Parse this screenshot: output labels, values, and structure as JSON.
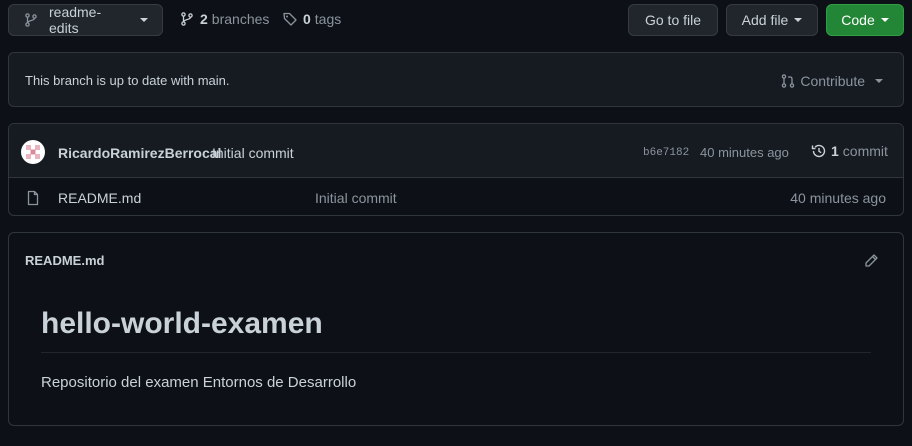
{
  "toolbar": {
    "branch_name": "readme-edits",
    "branches_count": "2",
    "branches_label": "branches",
    "tags_count": "0",
    "tags_label": "tags",
    "go_to_file": "Go to file",
    "add_file": "Add file",
    "code": "Code"
  },
  "branch_status": {
    "message": "This branch is up to date with main.",
    "contribute": "Contribute"
  },
  "latest_commit": {
    "author": "RicardoRamirezBerrocal",
    "message": "Initial commit",
    "sha": "b6e7182",
    "time": "40 minutes ago",
    "commits_count": "1",
    "commits_label": "commit"
  },
  "files": [
    {
      "name": "README.md",
      "commit_message": "Initial commit",
      "time": "40 minutes ago"
    }
  ],
  "readme": {
    "filename": "README.md",
    "heading": "hello-world-examen",
    "body": "Repositorio del examen Entornos de Desarrollo"
  },
  "colors": {
    "background": "#0d1117",
    "border": "#30363d",
    "button_bg": "#21262d",
    "code_button": "#238636",
    "text": "#c9d1d9",
    "muted": "#8b949e"
  }
}
